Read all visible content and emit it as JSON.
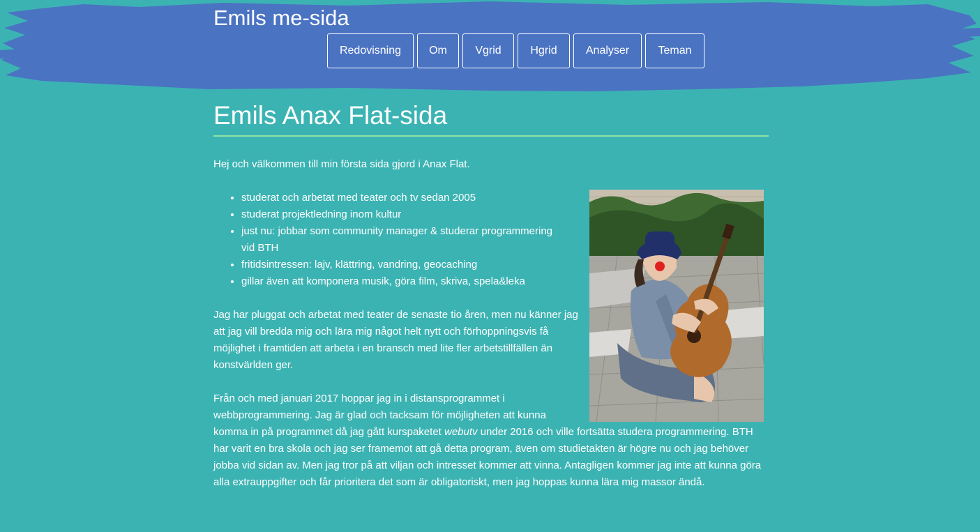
{
  "site": {
    "title": "Emils me-sida"
  },
  "nav": {
    "items": [
      {
        "label": "Redovisning"
      },
      {
        "label": "Om"
      },
      {
        "label": "Vgrid"
      },
      {
        "label": "Hgrid"
      },
      {
        "label": "Analyser"
      },
      {
        "label": "Teman"
      }
    ]
  },
  "main": {
    "title": "Emils Anax Flat-sida",
    "intro": "Hej och välkommen till min första sida gjord i Anax Flat.",
    "list": [
      "studerat och arbetat med teater och tv sedan 2005",
      "studerat projektledning inom kultur",
      "just nu: jobbar som community manager & studerar programmering vid BTH",
      "fritidsintressen: lajv, klättring, vandring, geocaching",
      "gillar även att komponera musik, göra film, skriva, spela&leka"
    ],
    "paragraph1": "Jag har pluggat och arbetat med teater de senaste tio åren, men nu känner jag att jag vill bredda mig och lära mig något helt nytt och förhoppningsvis få möjlighet i framtiden att arbeta i en bransch med lite fler arbetstillfällen än konstvärlden ger.",
    "paragraph2_part1": "Från och med januari 2017 hoppar jag in i distansprogrammet i webbprogrammering. Jag är glad och tacksam för möjligheten att kunna komma in på programmet då jag gått kurspaketet ",
    "paragraph2_em": "webutv",
    "paragraph2_part2": " under 2016 och ville fortsätta studera programmering. BTH har varit en bra skola och jag ser framemot att gå detta program, även om studietakten är högre nu och jag behöver jobba vid sidan av. Men jag tror på att viljan och intresset kommer att vinna. Antagligen kommer jag inte att kunna göra alla extrauppgifter och får prioritera det som är obligatoriskt, men jag hoppas kunna lära mig massor ändå."
  },
  "colors": {
    "background": "#3cb3b3",
    "header_brush": "#4a73c2",
    "title_underline": "#8fe3a3",
    "text": "#ffffff"
  }
}
